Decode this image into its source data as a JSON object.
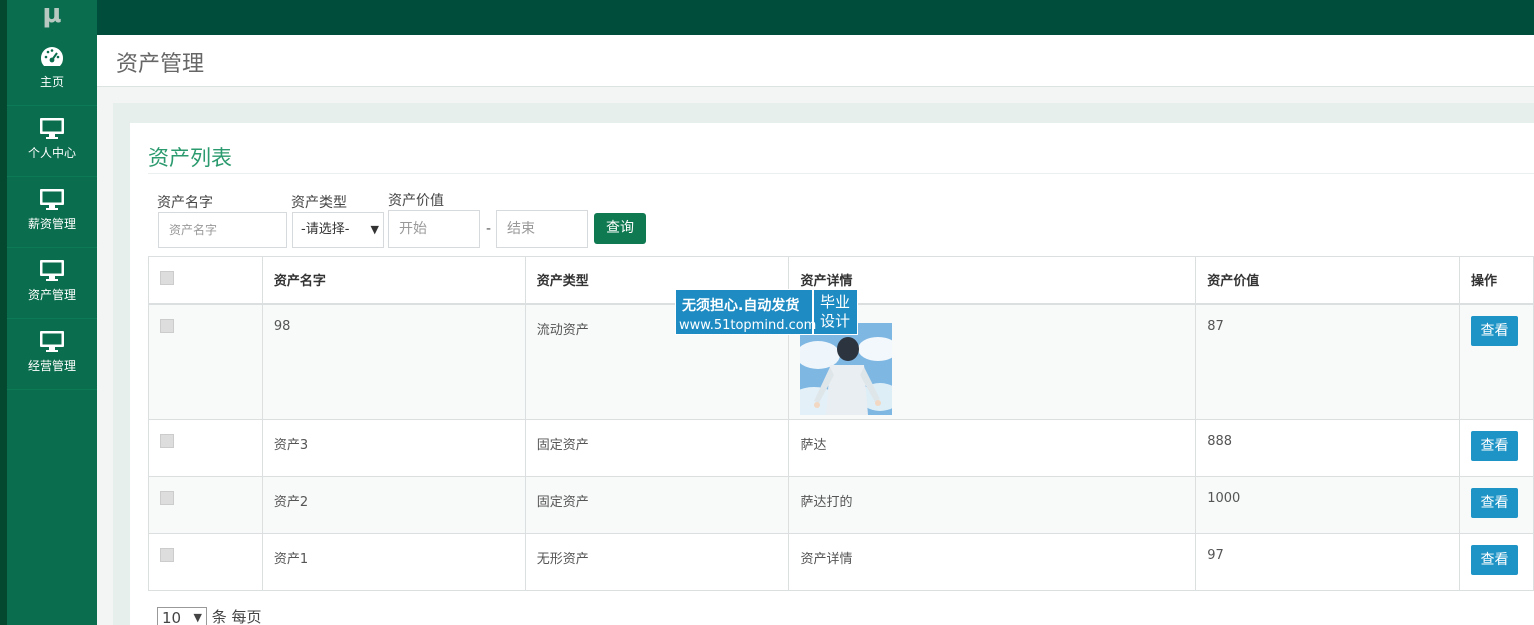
{
  "app": {
    "logo_char": "μ"
  },
  "sidebar": {
    "items": [
      {
        "label": "主页",
        "icon": "dashboard-icon"
      },
      {
        "label": "个人中心",
        "icon": "monitor-icon"
      },
      {
        "label": "薪资管理",
        "icon": "monitor-icon"
      },
      {
        "label": "资产管理",
        "icon": "monitor-icon"
      },
      {
        "label": "经营管理",
        "icon": "monitor-icon"
      }
    ]
  },
  "header": {
    "title": "资产管理"
  },
  "panel": {
    "title": "资产列表"
  },
  "search": {
    "name_label": "资产名字",
    "name_placeholder": "资产名字",
    "type_label": "资产类型",
    "type_selected": "-请选择-",
    "value_label": "资产价值",
    "start_placeholder": "开始",
    "range_sep": "-",
    "end_placeholder": "结束",
    "query_label": "查询"
  },
  "table": {
    "headers": [
      "资产名字",
      "资产类型",
      "资产详情",
      "资产价值",
      "操作"
    ],
    "rows": [
      {
        "name": "98",
        "type": "流动资产",
        "detail": "",
        "value": "87",
        "action": "查看"
      },
      {
        "name": "资产3",
        "type": "固定资产",
        "detail": "萨达",
        "value": "888",
        "action": "查看"
      },
      {
        "name": "资产2",
        "type": "固定资产",
        "detail": "萨达打的",
        "value": "1000",
        "action": "查看"
      },
      {
        "name": "资产1",
        "type": "无形资产",
        "detail": "资产详情",
        "value": "97",
        "action": "查看"
      }
    ]
  },
  "watermark": {
    "line1": "无须担心.自动发货",
    "line2": "www.51topmind.com",
    "box_line1": "毕业",
    "box_line2": "设计"
  },
  "pager": {
    "page_size": "10",
    "suffix": "条 每页"
  },
  "colors": {
    "sidebar": "#0a6d4d",
    "topbar": "#004d3c",
    "accent": "#2b9a6e",
    "query_button": "#0f7a52",
    "view_button": "#1d93c6"
  }
}
